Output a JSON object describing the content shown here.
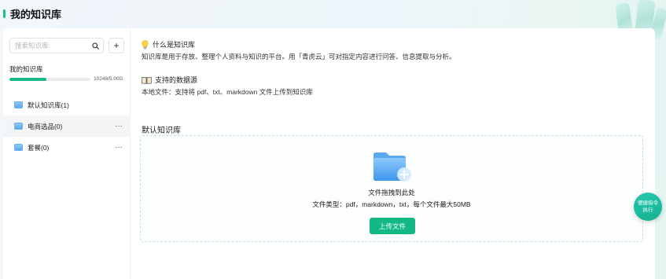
{
  "page": {
    "title": "我的知识库"
  },
  "sidebar": {
    "search_placeholder": "搜索知识库",
    "add_label": "+",
    "kb_label": "我的知识库",
    "quota": {
      "used_fraction": 0.46,
      "text": "10248/5.00G"
    },
    "items": [
      {
        "label": "默认知识库(1)"
      },
      {
        "label": "电商选品(0)",
        "more": "···"
      },
      {
        "label": "套餐(0)",
        "more": "···"
      }
    ]
  },
  "main": {
    "info_title": "什么是知识库",
    "info_desc": "知识库是用于存放、整理个人资料与知识的平台。用「青虎云」可对指定内容进行问答、信息提取与分析。",
    "sources_title": "支持的数据源",
    "sources_desc": "本地文件：支持将 pdf、txt、markdown 文件上传到知识库",
    "section_title": "默认知识库",
    "dropzone": {
      "drop_text": "文件拖拽到此处",
      "file_types": "文件类型：pdf，markdown，txt，每个文件最大50MB",
      "upload_label": "上传文件"
    }
  },
  "floating": {
    "quick_exec_label": "便捷指令执行"
  },
  "colors": {
    "accent": "#12b886",
    "quota_fill": "#17b98a",
    "folder": "#5aa9ee"
  }
}
